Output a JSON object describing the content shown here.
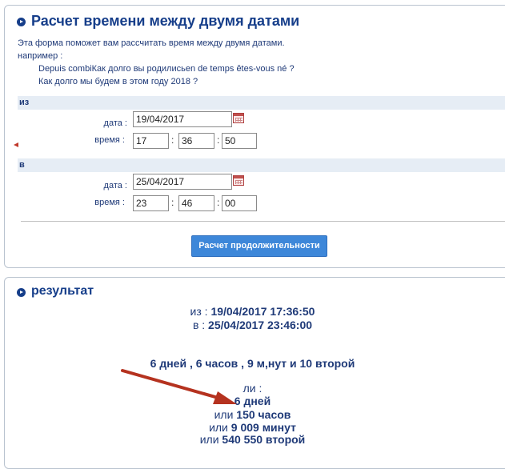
{
  "form": {
    "title": "Расчет времени между двумя датами",
    "intro_line1": "Эта форма поможет вам рассчитать время между двумя датами.",
    "intro_line2": "например :",
    "example1": "Depuis combiКак долго вы родилисьеn de temps êtes-vous né ?",
    "example2": "Как долго мы будем в этом году 2018 ?",
    "from_label": "из",
    "to_label": "в",
    "date_label": "дата :",
    "time_label": "время :",
    "from": {
      "date": "19/04/2017",
      "hour": "17",
      "minute": "36",
      "second": "50"
    },
    "to": {
      "date": "25/04/2017",
      "hour": "23",
      "minute": "46",
      "second": "00"
    },
    "time_sep": ":",
    "calc_button": "Расчет продолжительности"
  },
  "result": {
    "title": "результат",
    "from_prefix": "из :",
    "from_value": "19/04/2017 17:36:50",
    "to_prefix": "в :",
    "to_value": "25/04/2017 23:46:00",
    "summary": "6 дней , 6 часов , 9 м,нут и 10 второй",
    "or_label": "ли :",
    "days": "6 дней",
    "hours_prefix": "или",
    "hours": "150 часов",
    "minutes_prefix": "или",
    "minutes": "9 009 минут",
    "seconds_prefix": "или",
    "seconds": "540 550 второй"
  }
}
